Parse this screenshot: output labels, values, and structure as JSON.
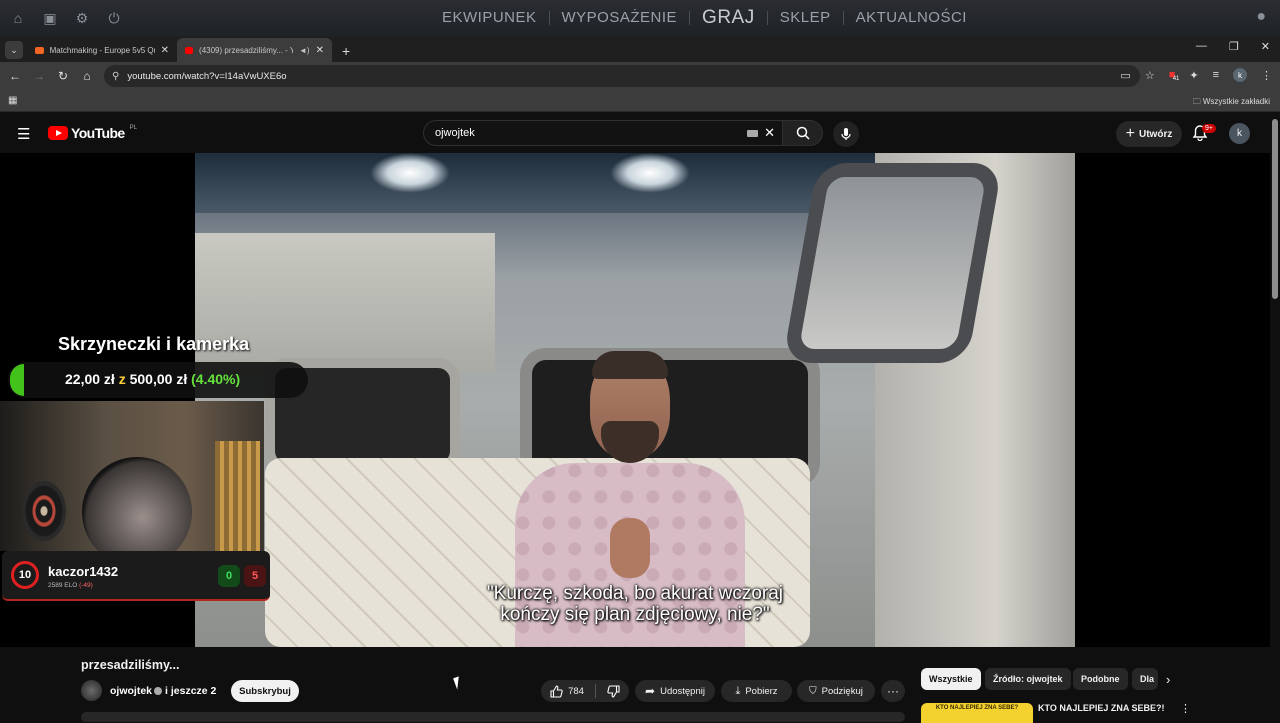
{
  "game_bar": {
    "nav": [
      "EKWIPUNEK",
      "WYPOSAŻENIE",
      "GRAJ",
      "SKLEP",
      "AKTUALNOŚCI"
    ],
    "active": "GRAJ"
  },
  "browser": {
    "tabs": [
      {
        "title": "Matchmaking - Europe 5v5 Qu",
        "active": false
      },
      {
        "title": "(4309) przesadziliśmy... - Yo",
        "active": true
      }
    ],
    "url": "youtube.com/watch?v=I14aVwUXE6o",
    "bookmarks_all": "Wszystkie zakładki",
    "ext_badge": "41",
    "profile_letter": "k"
  },
  "youtube": {
    "logo": "YouTube",
    "region": "PL",
    "search_value": "ojwojtek",
    "create_label": "Utwórz",
    "notif_badge": "9+",
    "avatar_letter": "k"
  },
  "video": {
    "subtitle_line1": "\"Kurczę, szkoda, bo akurat wczoraj",
    "subtitle_line2": "kończy się plan zdjęciowy, nie?\"",
    "overlay": {
      "donation_title": "Skrzyneczki i kamerka",
      "donation_current": "22,00 zł",
      "donation_of": "z",
      "donation_goal": "500,00 zł",
      "donation_pct": "(4.40%)",
      "donation_fraction": 0.044,
      "faceit_level": "10",
      "faceit_nick": "kaczor1432",
      "faceit_elo": "2589 ELO",
      "faceit_elo_change": "(-49)",
      "faceit_wins": "0",
      "faceit_losses": "5"
    }
  },
  "below": {
    "title": "przesadziliśmy...",
    "channel": "ojwojtek",
    "collab": "i jeszcze 2",
    "subscribe": "Subskrybuj",
    "likes": "784",
    "share": "Udostępnij",
    "download": "Pobierz",
    "thanks": "Podziękuj"
  },
  "chips": [
    "Wszystkie",
    "Źródło: ojwojtek",
    "Podobne",
    "Dla"
  ],
  "recommended": {
    "title": "KTO NAJLEPIEJ ZNA SEBE?!",
    "thumb_text": "KTO NAJLEPIEJ ZNA SEBE?"
  },
  "colors": {
    "youtube_red": "#ff0000",
    "donation_green": "#43c21a",
    "faceit_red": "#e02020"
  }
}
